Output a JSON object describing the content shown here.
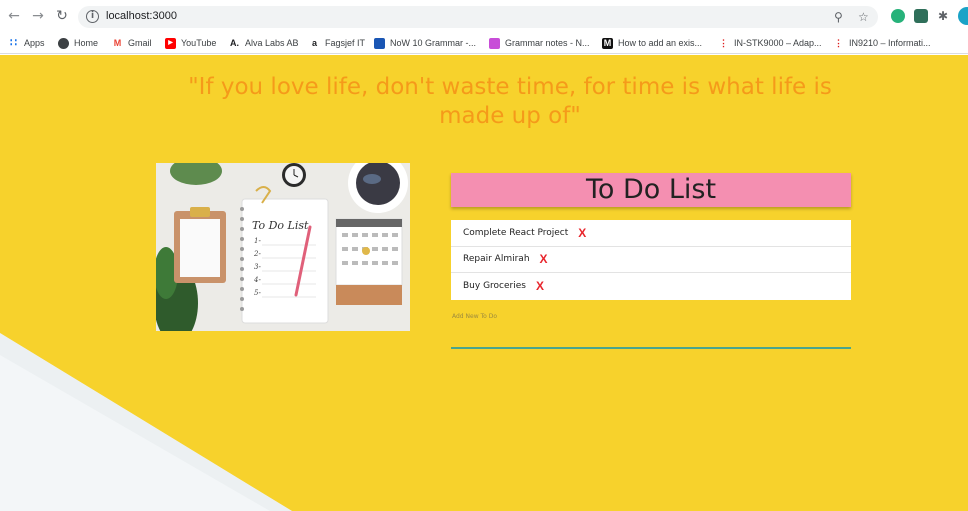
{
  "browser": {
    "url": "localhost:3000",
    "bookmarks": [
      {
        "label": "Apps",
        "icon": "apps-grid-icon",
        "color": "#1a73e8"
      },
      {
        "label": "Home",
        "icon": "home-globe-icon",
        "color": "#3c4043"
      },
      {
        "label": "Gmail",
        "icon": "gmail-icon",
        "color": "#ea4335"
      },
      {
        "label": "YouTube",
        "icon": "youtube-icon",
        "color": "#ff0000"
      },
      {
        "label": "Alva Labs AB",
        "icon": "alva-labs-icon",
        "color": "#202124"
      },
      {
        "label": "Fagsjef IT",
        "icon": "fagsjef-icon",
        "color": "#202124"
      },
      {
        "label": "NoW 10 Grammar -...",
        "icon": "now-icon",
        "color": "#1a56b4"
      },
      {
        "label": "Grammar notes - N...",
        "icon": "grammar-notes-icon",
        "color": "#c84dd8"
      },
      {
        "label": "How to add an exis...",
        "icon": "medium-icon",
        "color": "#111111"
      },
      {
        "label": "IN-STK9000 – Adap...",
        "icon": "uio-icon",
        "color": "#dd1a1a"
      },
      {
        "label": "IN9210 – Informati...",
        "icon": "uio-icon",
        "color": "#dd1a1a"
      }
    ]
  },
  "page": {
    "quote": "\"If you love life, don't waste time, for time is what life is made up of\"",
    "title": "To Do List",
    "todos": [
      {
        "text": "Complete React Project",
        "delete": "X"
      },
      {
        "text": "Repair Almirah",
        "delete": "X"
      },
      {
        "text": "Buy Groceries",
        "delete": "X"
      }
    ],
    "add_label": "Add New To Do",
    "hero_image_text": "To Do List",
    "hero_items": [
      "1-",
      "2-",
      "3-",
      "4-",
      "5-"
    ]
  },
  "colors": {
    "page_bg": "#f7d22c",
    "quote": "#f59a1a",
    "header_bg": "#f48fb1",
    "delete": "#e8252c",
    "input_underline": "#4aa58d"
  }
}
